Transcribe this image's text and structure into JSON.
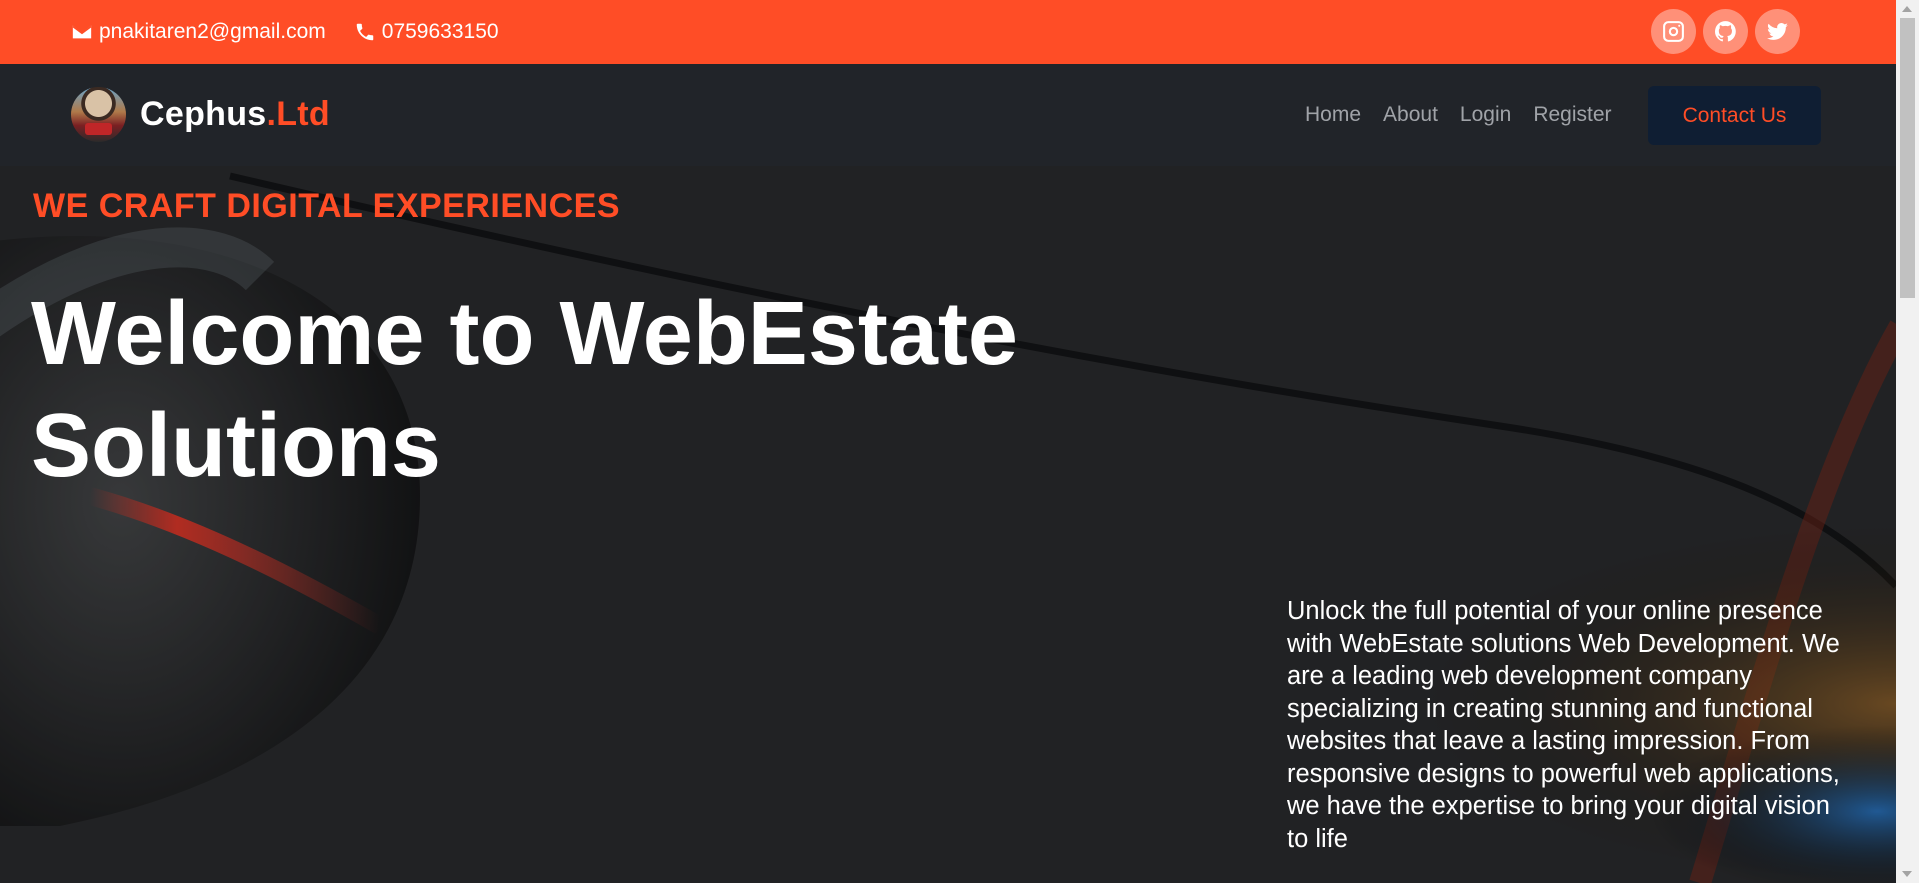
{
  "topbar": {
    "email": "pnakitaren2@gmail.com",
    "phone": "0759633150",
    "email_icon": "envelope-icon",
    "phone_icon": "phone-icon",
    "socials": [
      "instagram-icon",
      "github-icon",
      "twitter-icon"
    ]
  },
  "navbar": {
    "brand_main": "Cephus",
    "brand_accent": ".Ltd",
    "links": [
      "Home",
      "About",
      "Login",
      "Register"
    ],
    "cta": "Contact Us"
  },
  "hero": {
    "tagline": "WE CRAFT DIGITAL EXPERIENCES",
    "title": "Welcome to WebEstate Solutions",
    "description": "Unlock the full potential of your online presence with WebEstate solutions Web Development. We are a leading web development company specializing in creating stunning and functional websites that leave a lasting impression. From responsive designs to powerful web applications, we have the expertise to bring your digital vision to life"
  },
  "colors": {
    "accent": "#ff4d26",
    "navbar_bg": "#212429",
    "cta_bg": "#0f1e33"
  }
}
